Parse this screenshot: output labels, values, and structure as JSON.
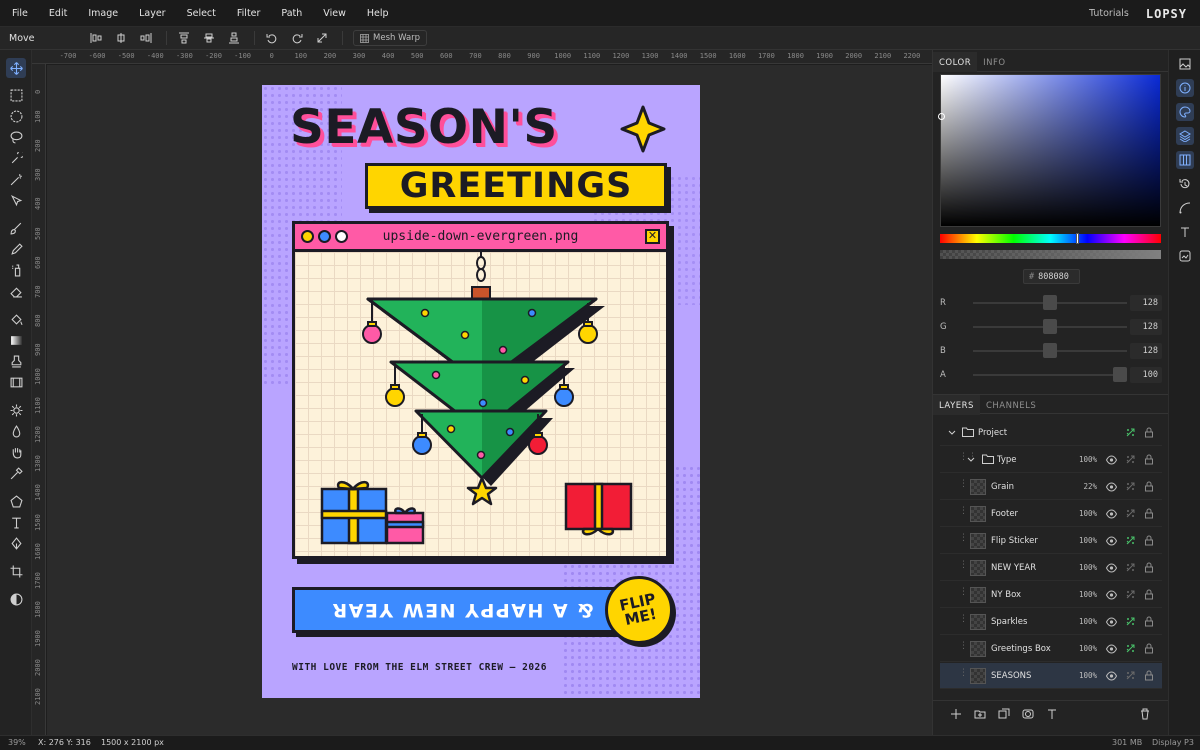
{
  "menu": [
    "File",
    "Edit",
    "Image",
    "Layer",
    "Select",
    "Filter",
    "Path",
    "View",
    "Help"
  ],
  "header": {
    "tutorials": "Tutorials",
    "brand": "LOPSY"
  },
  "options": {
    "tool_name": "Move",
    "mesh_warp": "Mesh Warp"
  },
  "ruler_top": [
    "-700",
    "-600",
    "-500",
    "-400",
    "-300",
    "-200",
    "-100",
    "0",
    "100",
    "200",
    "300",
    "400",
    "500",
    "600",
    "700",
    "800",
    "900",
    "1000",
    "1100",
    "1200",
    "1300",
    "1400",
    "1500",
    "1600",
    "1700",
    "1800",
    "1900",
    "2000",
    "2100",
    "2200"
  ],
  "ruler_left": [
    "0",
    "100",
    "200",
    "300",
    "400",
    "500",
    "600",
    "700",
    "800",
    "900",
    "1000",
    "1100",
    "1200",
    "1300",
    "1400",
    "1500",
    "1600",
    "1700",
    "1800",
    "1900",
    "2000",
    "2100"
  ],
  "poster": {
    "headline": "SEASON'S",
    "subheadline": "GREETINGS",
    "window_title": "upside-down-evergreen.png",
    "close_glyph": "✕",
    "banner": "& A HAPPY NEW YEAR",
    "sticker": "FLIP\nME!",
    "footer": "WITH LOVE FROM THE ELM STREET CREW — 2026"
  },
  "color_panel": {
    "tabs": [
      "COLOR",
      "INFO"
    ],
    "hex": "808080",
    "channels": [
      {
        "label": "R",
        "value": "128",
        "level": 0.5
      },
      {
        "label": "G",
        "value": "128",
        "level": 0.5
      },
      {
        "label": "B",
        "value": "128",
        "level": 0.5
      },
      {
        "label": "A",
        "value": "100",
        "level": 1.0
      }
    ]
  },
  "layers_panel": {
    "tabs": [
      "LAYERS",
      "CHANNELS"
    ],
    "layers": [
      {
        "name": "Project",
        "pct": "",
        "kind": "group-root"
      },
      {
        "name": "Type",
        "pct": "100%",
        "kind": "group"
      },
      {
        "name": "Grain",
        "pct": "22%",
        "kind": "layer"
      },
      {
        "name": "Footer",
        "pct": "100%",
        "kind": "layer"
      },
      {
        "name": "Flip Sticker",
        "pct": "100%",
        "kind": "layer"
      },
      {
        "name": "NEW YEAR",
        "pct": "100%",
        "kind": "layer"
      },
      {
        "name": "NY Box",
        "pct": "100%",
        "kind": "layer"
      },
      {
        "name": "Sparkles",
        "pct": "100%",
        "kind": "layer"
      },
      {
        "name": "Greetings Box",
        "pct": "100%",
        "kind": "layer"
      },
      {
        "name": "SEASONS",
        "pct": "100%",
        "kind": "layer",
        "selected": true
      }
    ]
  },
  "status": {
    "zoom": "39%",
    "coords": "X: 276 Y: 316",
    "doc_size": "1500 x 2100 px",
    "memory": "301 MB",
    "profile": "Display P3"
  },
  "colors": {
    "accent": "#4a8cff",
    "poster_bg": "#b9a4ff",
    "pink": "#ff5aa6",
    "yellow": "#ffd500",
    "blue": "#3d8bff",
    "green": "#22b35a"
  }
}
